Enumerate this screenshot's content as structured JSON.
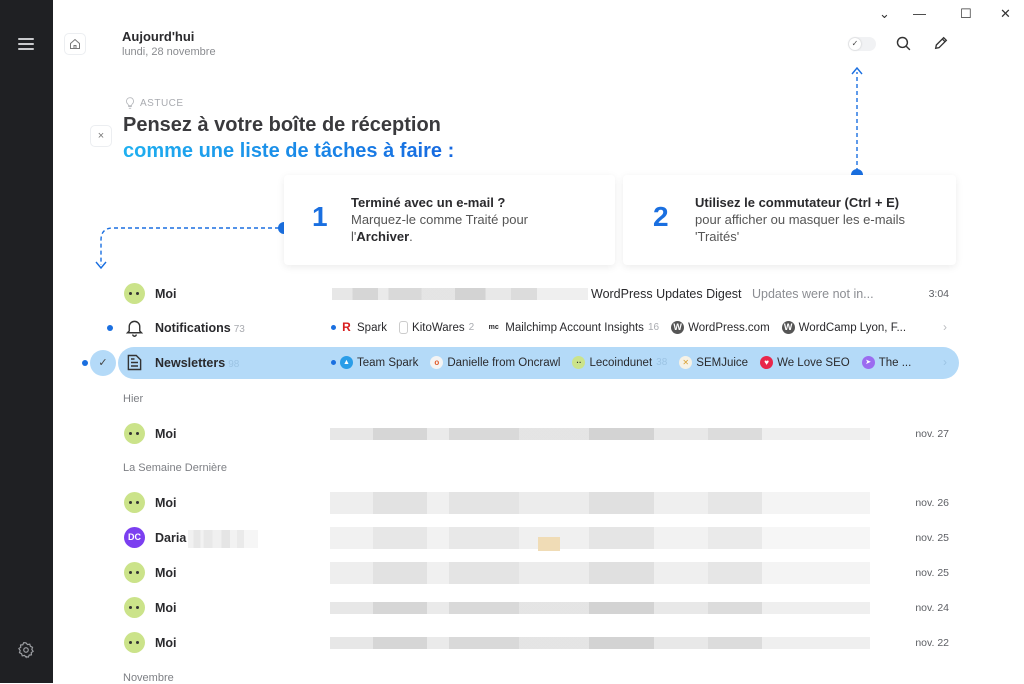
{
  "header": {
    "title": "Aujourd'hui",
    "subtitle": "lundi, 28 novembre"
  },
  "window_controls": {
    "dropdown": "⌄",
    "minimize": "—",
    "maximize": "☐",
    "close": "✕"
  },
  "toolbar": {
    "toggle_check": "✓"
  },
  "tip": {
    "label": "ASTUCE",
    "title_line1": "Pensez à votre boîte de réception",
    "title_line2": "comme une liste de tâches à faire :",
    "close": "×",
    "cards": [
      {
        "number": "1",
        "heading": "Terminé avec un e-mail ?",
        "body": "Marquez-le comme Traité pour l'",
        "bold": "Archiver",
        "tail": "."
      },
      {
        "number": "2",
        "heading": "Utilisez le commutateur (Ctrl + E)",
        "body": "pour afficher ou masquer les e-mails 'Traités'"
      }
    ]
  },
  "today": [
    {
      "name": "Moi",
      "subject": "WordPress Updates Digest",
      "preview": "Updates were not in...",
      "date": "3:04"
    },
    {
      "name": "Notifications",
      "count": "73",
      "senders": [
        {
          "name": "Spark",
          "icon": "R"
        },
        {
          "name": "KitoWares",
          "count": "2",
          "icon": "bell"
        },
        {
          "name": "Mailchimp Account Insights",
          "count": "16",
          "icon": "mc"
        },
        {
          "name": "WordPress.com",
          "icon": "W"
        },
        {
          "name": "WordCamp Lyon, F...",
          "icon": "W"
        }
      ],
      "chevron": "›"
    },
    {
      "name": "Newsletters",
      "count": "98",
      "selected": true,
      "senders": [
        {
          "name": "Team Spark",
          "icon": "▲"
        },
        {
          "name": "Danielle from Oncrawl",
          "icon": "o"
        },
        {
          "name": "Lecoindunet",
          "count": "38",
          "icon": "··"
        },
        {
          "name": "SEMJuice",
          "icon": "✕"
        },
        {
          "name": "We Love SEO",
          "icon": "♥"
        },
        {
          "name": "The ...",
          "icon": "➤"
        }
      ],
      "chevron": "›"
    }
  ],
  "sections": {
    "yesterday": "Hier",
    "last_week": "La Semaine Dernière",
    "november": "Novembre"
  },
  "yesterday": [
    {
      "name": "Moi",
      "date": "nov. 27"
    }
  ],
  "last_week": [
    {
      "name": "Moi",
      "date": "nov. 26"
    },
    {
      "name": "Daria",
      "initials": "DC",
      "date": "nov. 25"
    },
    {
      "name": "Moi",
      "date": "nov. 25"
    },
    {
      "name": "Moi",
      "date": "nov. 24"
    },
    {
      "name": "Moi",
      "date": "nov. 22"
    }
  ],
  "colors": {
    "accent": "#1a6fe0",
    "selected_row": "#b4daf8",
    "sidebar": "#1f2023"
  }
}
